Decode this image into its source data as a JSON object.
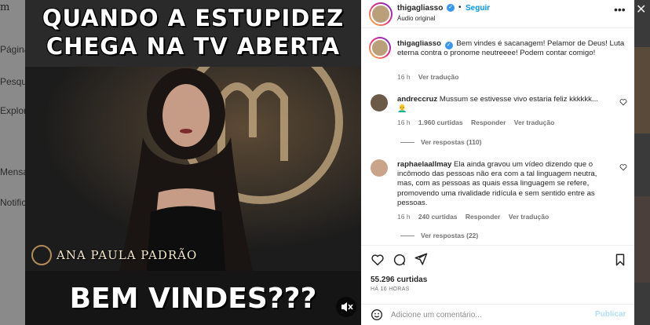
{
  "background": {
    "logo": "m",
    "nav": [
      "Página inicial",
      "Pesquisa",
      "Explorar",
      "Mensagens",
      "Notificações"
    ]
  },
  "media": {
    "headline_line1": "QUANDO A ESTUPIDEZ",
    "headline_line2": "CHEGA NA TV ABERTA",
    "name_plate": "ANA PAULA PADRÃO",
    "bottom_text": "BEM VINDES???"
  },
  "header": {
    "username": "thigagliasso",
    "follow_label": "Seguir",
    "subtitle": "Áudio original"
  },
  "caption": {
    "username": "thigagliasso",
    "text": "Bem vindes é sacanagem! Pelamor de Deus! Luta eterna contra o pronome neutreeee! Podem contar comigo!",
    "time": "16 h",
    "translate": "Ver tradução"
  },
  "comments": [
    {
      "username": "andreccruz",
      "text": "Mussum se estivesse vivo estaria feliz kkkkkk...",
      "emoji": "👨‍🦲",
      "time": "16 h",
      "likes": "1.960 curtidas",
      "reply": "Responder",
      "translate": "Ver tradução",
      "view_replies": "Ver respostas (110)"
    },
    {
      "username": "raphaelaallmay",
      "text": "Ela ainda gravou um vídeo dizendo que o incômodo das pessoas não era com a tal linguagem neutra, mas, com as pessoas as quais essa linguagem se refere, promovendo uma rivalidade ridícula e sem sentido entre as pessoas.",
      "time": "16 h",
      "likes": "240 curtidas",
      "reply": "Responder",
      "translate": "Ver tradução",
      "view_replies": "Ver respostas (22)"
    }
  ],
  "footer": {
    "likes": "55.296 curtidas",
    "date": "HÁ 16 HORAS",
    "comment_placeholder": "Adicione um comentário...",
    "publish_label": "Publicar"
  },
  "colors": {
    "link_blue": "#0095f6",
    "verified_blue": "#3897f0",
    "muted_text": "#737373"
  }
}
